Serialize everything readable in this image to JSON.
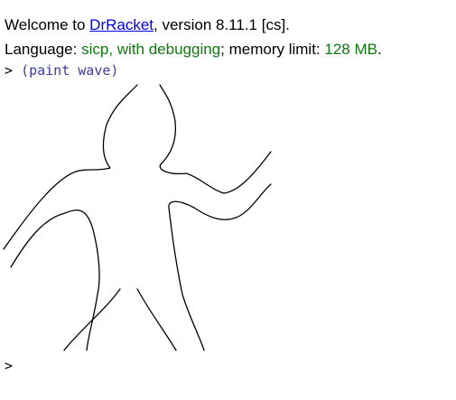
{
  "banner": {
    "welcome_prefix": "Welcome to ",
    "app_link": "DrRacket",
    "version_text": ", version 8.11.1 [cs].",
    "language_prefix": "Language: ",
    "language_name": "sicp, with debugging",
    "memory_prefix": "; memory limit: ",
    "memory_value": "128 MB",
    "memory_suffix": "."
  },
  "repl": {
    "prompt_symbol": ">",
    "expression": "(paint wave)",
    "next_prompt_symbol": ">"
  },
  "colors": {
    "link": "#0000ee",
    "language_green": "#117711",
    "expression_blue": "#3b3b9c"
  },
  "image_output": {
    "description_icon": "wave-figure-drawing"
  }
}
